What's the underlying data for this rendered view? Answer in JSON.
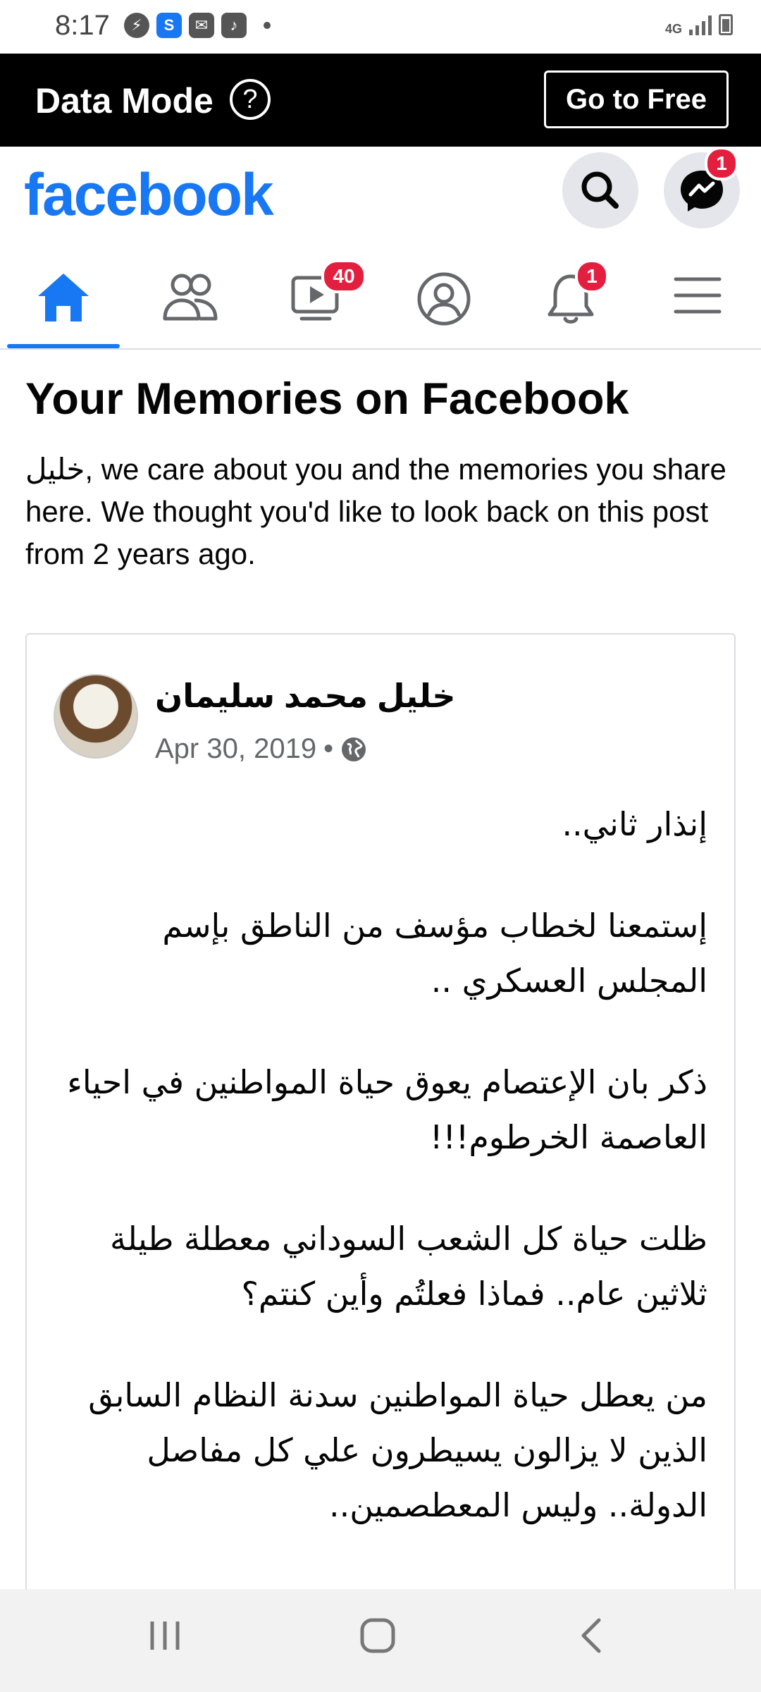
{
  "status_bar": {
    "time": "8:17",
    "network": "4G",
    "notification_icons": [
      "bolt-icon",
      "shazam-icon",
      "mail-icon",
      "music-icon"
    ]
  },
  "data_mode": {
    "title": "Data Mode",
    "help_symbol": "?",
    "go_to_free": "Go to Free"
  },
  "header": {
    "logo": "facebook",
    "messenger_badge": "1"
  },
  "tabs": [
    {
      "name": "home",
      "icon": "home-icon",
      "active": true
    },
    {
      "name": "friends",
      "icon": "friends-icon"
    },
    {
      "name": "watch",
      "icon": "watch-icon",
      "badge": "40"
    },
    {
      "name": "profile",
      "icon": "profile-icon"
    },
    {
      "name": "notifications",
      "icon": "bell-icon",
      "badge": "1"
    },
    {
      "name": "menu",
      "icon": "menu-icon"
    }
  ],
  "memories": {
    "heading": "Your Memories on Facebook",
    "intro": "خليل, we care about you and the memories you share here. We thought you'd like to look back on this post from 2 years ago."
  },
  "post": {
    "author": "خليل محمد سليمان",
    "date": "Apr 30, 2019",
    "separator": "•",
    "privacy_icon": "globe-icon",
    "paragraphs": [
      "إنذار ثاني..",
      "إستمعنا لخطاب مؤسف من الناطق بإسم المجلس العسكري ..",
      "ذكر بان الإعتصام يعوق حياة المواطنين في احياء العاصمة الخرطوم!!!",
      "ظلت حياة كل الشعب السوداني معطلة طيلة ثلاثين عام.. فماذا فعلتُم وأين كنتم؟",
      "من يعطل حياة المواطنين سدنة النظام السابق الذين لا يزالون يسيطرون علي كل مفاصل الدولة.. وليس المعطصمين.."
    ]
  },
  "colors": {
    "brand": "#1877f2",
    "badge": "#e41e3f"
  }
}
